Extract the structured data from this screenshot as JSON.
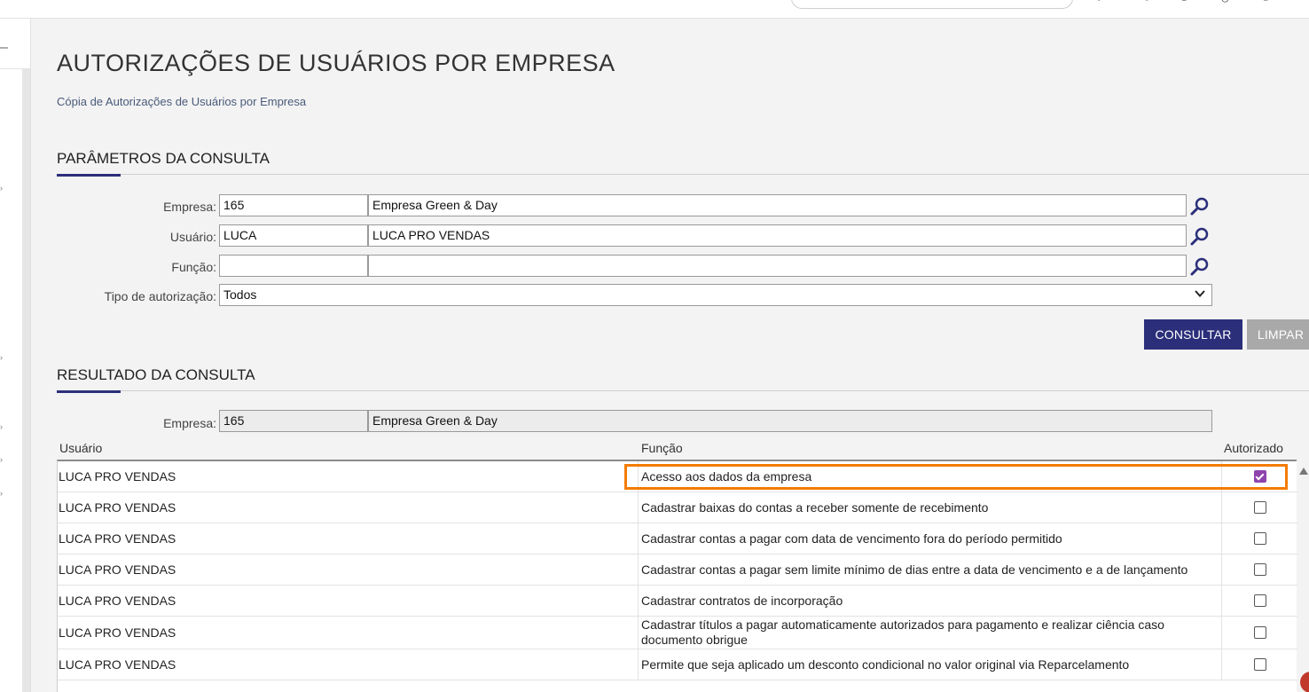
{
  "header": {
    "title": "AUTORIZAÇÕES DE USUÁRIOS POR EMPRESA",
    "copy_link": "Cópia de Autorizações de Usuários por Empresa"
  },
  "params": {
    "section_title": "PARÂMETROS DA CONSULTA",
    "empresa_label": "Empresa:",
    "empresa_code": "165",
    "empresa_name": "Empresa Green & Day",
    "usuario_label": "Usuário:",
    "usuario_code": "LUCA",
    "usuario_name": "LUCA PRO VENDAS",
    "funcao_label": "Função:",
    "funcao_code": "",
    "funcao_name": "",
    "tipo_label": "Tipo de autorização:",
    "tipo_value": "Todos",
    "consultar_label": "CONSULTAR",
    "limpar_label": "LIMPAR"
  },
  "result": {
    "section_title": "RESULTADO DA CONSULTA",
    "empresa_label": "Empresa:",
    "empresa_code": "165",
    "empresa_name": "Empresa Green & Day",
    "columns": {
      "usuario": "Usuário",
      "funcao": "Função",
      "autorizado": "Autorizado"
    },
    "rows": [
      {
        "usuario": "LUCA PRO VENDAS",
        "funcao": "Acesso aos dados da empresa",
        "autorizado": true
      },
      {
        "usuario": "LUCA PRO VENDAS",
        "funcao": "Cadastrar baixas do contas a receber somente de recebimento",
        "autorizado": false
      },
      {
        "usuario": "LUCA PRO VENDAS",
        "funcao": "Cadastrar contas a pagar com data de vencimento fora do período permitido",
        "autorizado": false
      },
      {
        "usuario": "LUCA PRO VENDAS",
        "funcao": "Cadastrar contas a pagar sem limite mínimo de dias entre a data de vencimento e a de lançamento",
        "autorizado": false
      },
      {
        "usuario": "LUCA PRO VENDAS",
        "funcao": "Cadastrar contratos de incorporação",
        "autorizado": false
      },
      {
        "usuario": "LUCA PRO VENDAS",
        "funcao": "Cadastrar títulos a pagar automaticamente autorizados para pagamento e realizar ciência caso documento obrigue",
        "autorizado": false
      },
      {
        "usuario": "LUCA PRO VENDAS",
        "funcao": "Permite que seja aplicado um desconto condicional no valor original via Reparcelamento",
        "autorizado": false
      }
    ]
  },
  "colors": {
    "primary": "#2b2f7a",
    "secondary_button": "#a9a9a9",
    "highlight": "#f47c00",
    "checkbox_checked": "#8e44ad"
  },
  "icons": {
    "lookup": "search-icon",
    "select": "chevron-down-icon",
    "scroll": "scroll-up-icon"
  }
}
